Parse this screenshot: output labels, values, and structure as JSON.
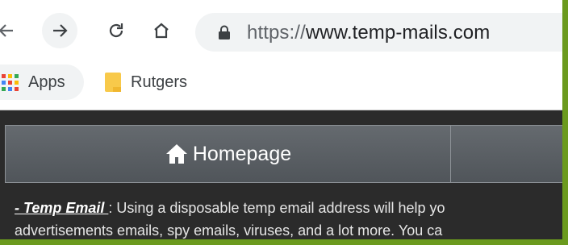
{
  "browser": {
    "url_scheme": "https://",
    "url_host": "www.temp-mails.com"
  },
  "bookmarks": [
    {
      "label": "Apps",
      "icon": "apps-grid-icon"
    },
    {
      "label": "Rutgers",
      "icon": "folder-icon"
    }
  ],
  "nav": {
    "home_label": "Homepage",
    "home_icon": "home-icon"
  },
  "intro": {
    "term": "- Temp Email ",
    "line1_rest": ": Using a disposable temp email address will help yo",
    "line2": "advertisements emails, spy emails, viruses, and a lot more. You ca"
  },
  "colors": {
    "frame": "#6b9a1e",
    "page_background": "#2b2b2b",
    "nav_tab": "#5a5f64",
    "apps_icon": [
      "#ea4335",
      "#fbbc04",
      "#34a853",
      "#4285f4",
      "#ea4335",
      "#fbbc04",
      "#34a853",
      "#4285f4",
      "#ea4335"
    ],
    "folder": "#f8c94a"
  }
}
